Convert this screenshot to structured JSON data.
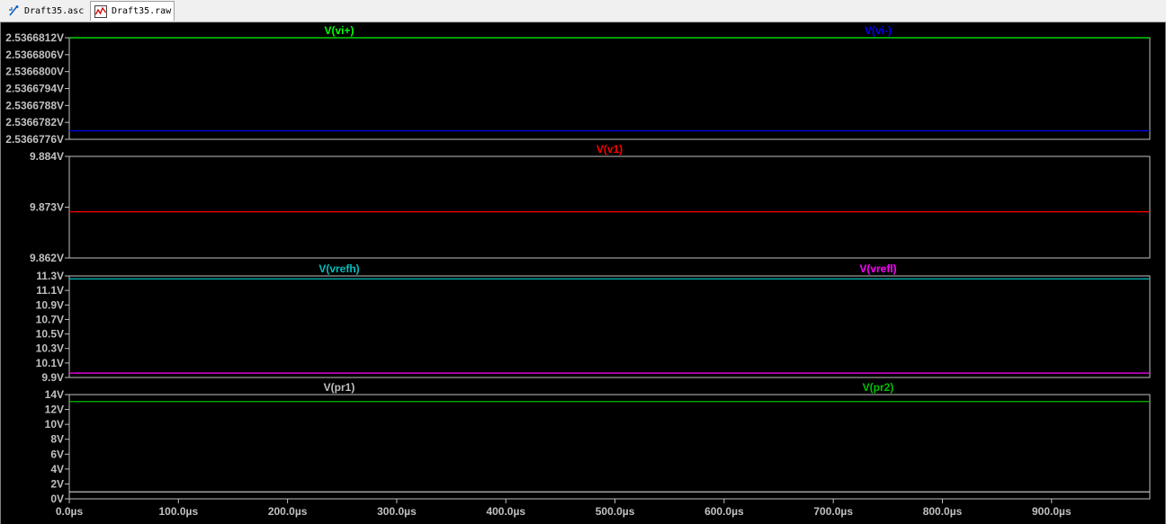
{
  "tabs": [
    {
      "label": "Draft35.asc",
      "icon": "schematic-icon"
    },
    {
      "label": "Draft35.raw",
      "icon": "waveform-icon"
    }
  ],
  "chart_data": [
    {
      "type": "line",
      "pane": 1,
      "ylim": [
        2.5366776,
        2.5366812
      ],
      "yticks": [
        "2.5366812V",
        "2.5366806V",
        "2.5366800V",
        "2.5366794V",
        "2.5366788V",
        "2.5366782V",
        "2.5366776V"
      ],
      "series": [
        {
          "name": "V(vi+)",
          "color": "#00ff00",
          "values": [
            2.5366812,
            2.5366812
          ]
        },
        {
          "name": "V(vi-)",
          "color": "#0000ff",
          "values": [
            2.5366779,
            2.5366779
          ]
        }
      ]
    },
    {
      "type": "line",
      "pane": 2,
      "ylim": [
        9.862,
        9.884
      ],
      "yticks": [
        "9.884V",
        "9.873V",
        "9.862V"
      ],
      "series": [
        {
          "name": "V(v1)",
          "color": "#ff0000",
          "values": [
            9.872,
            9.872
          ]
        }
      ]
    },
    {
      "type": "line",
      "pane": 3,
      "ylim": [
        9.9,
        11.3
      ],
      "yticks": [
        "11.3V",
        "11.1V",
        "10.9V",
        "10.7V",
        "10.5V",
        "10.3V",
        "10.1V",
        "9.9V"
      ],
      "series": [
        {
          "name": "V(vrefh)",
          "color": "#00c0c0",
          "values": [
            11.26,
            11.26
          ]
        },
        {
          "name": "V(vrefl)",
          "color": "#ff00ff",
          "values": [
            9.96,
            9.96
          ]
        }
      ]
    },
    {
      "type": "line",
      "pane": 4,
      "ylim": [
        0,
        15
      ],
      "yticks": [
        "14V",
        "12V",
        "10V",
        "8V",
        "6V",
        "4V",
        "2V",
        "0V"
      ],
      "series": [
        {
          "name": "V(pr1)",
          "color": "#c0c0c0",
          "values": [
            1,
            1
          ]
        },
        {
          "name": "V(pr2)",
          "color": "#00c000",
          "values": [
            14,
            14
          ]
        }
      ]
    }
  ],
  "x_axis": {
    "xlim": [
      0,
      990
    ],
    "unit": "µs",
    "ticks": [
      "0.0µs",
      "100.0µs",
      "200.0µs",
      "300.0µs",
      "400.0µs",
      "500.0µs",
      "600.0µs",
      "700.0µs",
      "800.0µs",
      "900.0µs"
    ],
    "tick_values": [
      0,
      100,
      200,
      300,
      400,
      500,
      600,
      700,
      800,
      900
    ]
  }
}
